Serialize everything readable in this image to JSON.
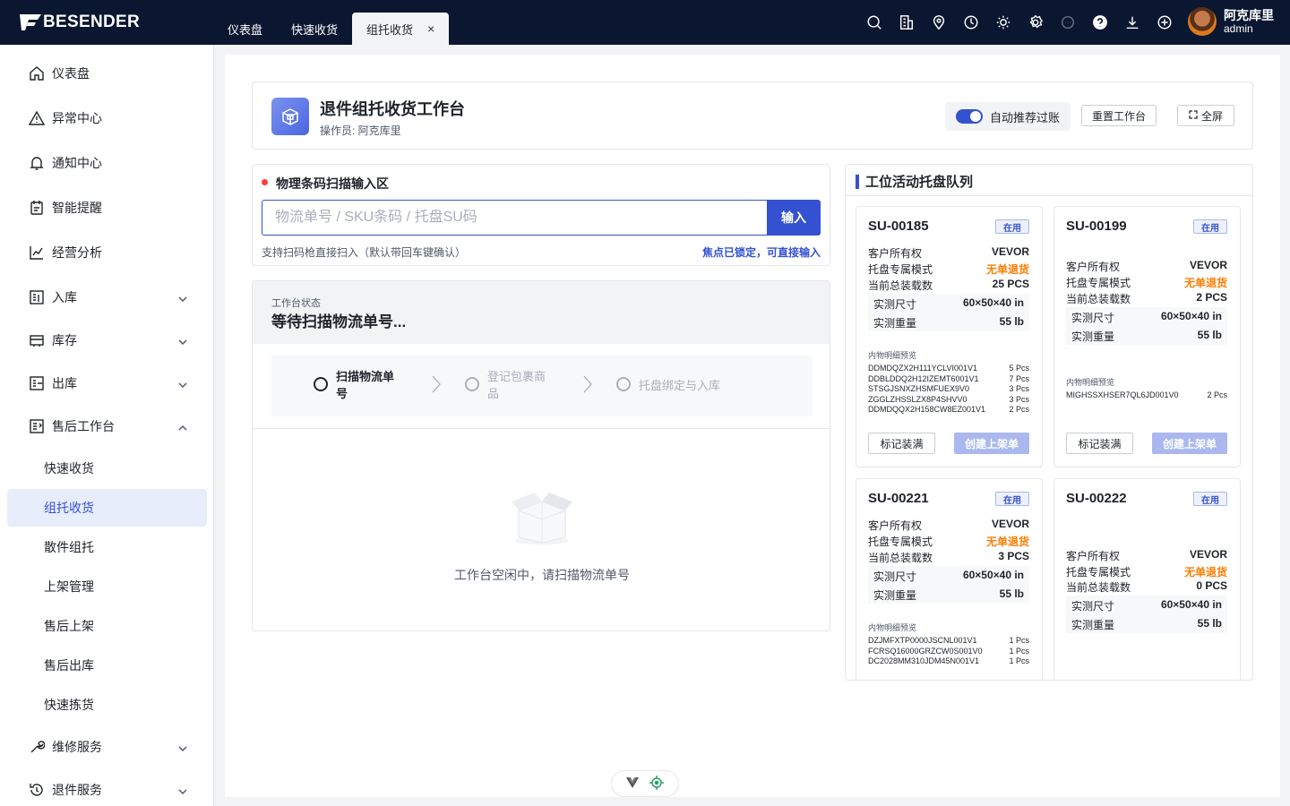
{
  "app": {
    "logo_text": "BESENDER"
  },
  "tabs": [
    {
      "label": "仪表盘"
    },
    {
      "label": "快速收货"
    },
    {
      "label": "组托收货",
      "active": true,
      "close": "×"
    }
  ],
  "top_icons": [
    "search-icon",
    "building-icon",
    "location-icon",
    "clock-icon",
    "sun-icon",
    "settings-icon",
    "chat-icon",
    "help-icon",
    "download-icon",
    "plus-circle-icon"
  ],
  "user": {
    "name": "阿克库里",
    "role": "admin"
  },
  "sidebar": {
    "items": [
      {
        "label": "仪表盘",
        "icon": "home-icon"
      },
      {
        "label": "异常中心",
        "icon": "warning-icon"
      },
      {
        "label": "通知中心",
        "icon": "bell-icon"
      },
      {
        "label": "智能提醒",
        "icon": "reminder-icon"
      },
      {
        "label": "经营分析",
        "icon": "chart-icon"
      },
      {
        "label": "入库",
        "icon": "inbound-icon"
      },
      {
        "label": "库存",
        "icon": "inventory-icon"
      },
      {
        "label": "出库",
        "icon": "outbound-icon"
      },
      {
        "label": "售后工作台",
        "icon": "aftersales-icon"
      }
    ],
    "sub_items": [
      {
        "label": "快速收货"
      },
      {
        "label": "组托收货",
        "active": true
      },
      {
        "label": "散件组托"
      },
      {
        "label": "上架管理"
      },
      {
        "label": "售后上架"
      },
      {
        "label": "售后出库"
      },
      {
        "label": "快速拣货"
      }
    ],
    "bottom_items": [
      {
        "label": "维修服务",
        "icon": "wrench-icon"
      },
      {
        "label": "退件服务",
        "icon": "return-icon"
      }
    ]
  },
  "header": {
    "title": "退件组托收货工作台",
    "operator": "操作员: 阿克库里",
    "auto_toggle_label": "自动推荐过账",
    "reset_label": "重置工作台",
    "fullscreen_label": "全屏"
  },
  "scan": {
    "title": "物理条码扫描输入区",
    "placeholder": "物流单号 / SKU条码 / 托盘SU码",
    "button": "输入",
    "hint": "支持扫码枪直接扫入（默认带回车键确认）",
    "lock_status": "焦点已锁定，可直接输入"
  },
  "status": {
    "label": "工作台状态",
    "text": "等待扫描物流单号...",
    "steps": [
      {
        "label": "扫描物流单号",
        "active": true
      },
      {
        "label": "登记包裹商品",
        "active": false
      },
      {
        "label": "托盘绑定与入库",
        "active": false
      }
    ],
    "empty_text": "工作台空闲中，请扫描物流单号"
  },
  "queue": {
    "title": "工位活动托盘队列",
    "labels": {
      "owner": "客户所有权",
      "mode": "托盘专属模式",
      "load": "当前总装载数",
      "size": "实测尺寸",
      "weight": "实测重量",
      "detail": "内物明细预览",
      "mark": "标记装满",
      "create": "创建上架单"
    },
    "pallets": [
      {
        "id": "SU-00185",
        "tag": "在用",
        "owner": "VEVOR",
        "mode": "无单退货",
        "load": "25 PCS",
        "size": "60×50×40 in",
        "weight": "55 lb",
        "details": [
          {
            "sku": "DDMDQZX2H111YCLVI001V1",
            "qty": "5 Pcs"
          },
          {
            "sku": "DDBLDDQ2H12IZEMT6001V1",
            "qty": "7 Pcs"
          },
          {
            "sku": "STSGJSNXZHSMFUEX9V0",
            "qty": "3 Pcs"
          },
          {
            "sku": "ZGGLZHSSLZX8P4SHVV0",
            "qty": "3 Pcs"
          },
          {
            "sku": "DDMDQQX2H158CW8EZ001V1",
            "qty": "2 Pcs"
          }
        ]
      },
      {
        "id": "SU-00199",
        "tag": "在用",
        "owner": "VEVOR",
        "mode": "无单退货",
        "load": "2 PCS",
        "size": "60×50×40 in",
        "weight": "55 lb",
        "details": [
          {
            "sku": "MIGHSSXHSER7QL6JD001V0",
            "qty": "2 Pcs"
          }
        ]
      },
      {
        "id": "SU-00221",
        "tag": "在用",
        "owner": "VEVOR",
        "mode": "无单退货",
        "load": "3 PCS",
        "size": "60×50×40 in",
        "weight": "55 lb",
        "details": [
          {
            "sku": "DZJMFXTP0000JSCNL001V1",
            "qty": "1 Pcs"
          },
          {
            "sku": "FCRSQ16000GRZCW0S001V0",
            "qty": "1 Pcs"
          },
          {
            "sku": "DC2028MM310JDM45N001V1",
            "qty": "1 Pcs"
          }
        ]
      },
      {
        "id": "SU-00222",
        "tag": "在用",
        "owner": "VEVOR",
        "mode": "无单退货",
        "load": "0 PCS",
        "size": "60×50×40 in",
        "weight": "55 lb",
        "details": []
      }
    ]
  },
  "colors": {
    "primary": "#3451d1",
    "topbar": "#0b1730",
    "orange": "#ff7d00"
  }
}
